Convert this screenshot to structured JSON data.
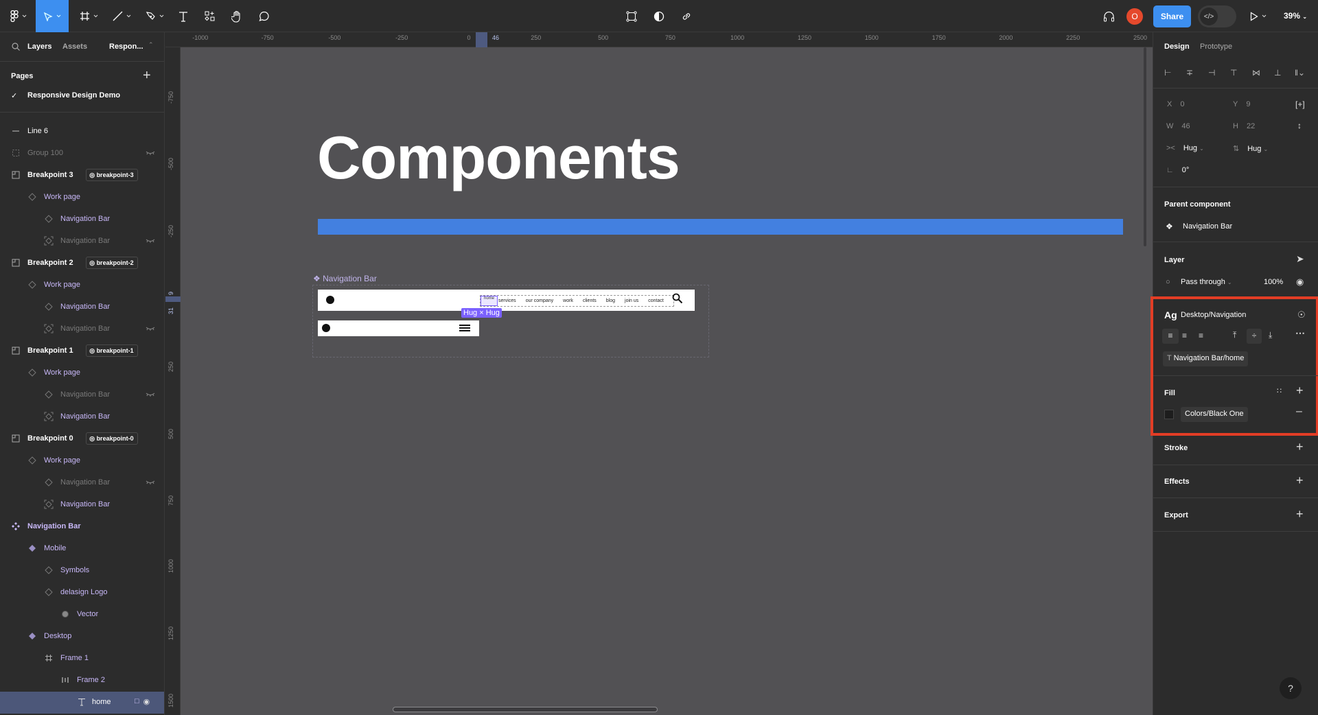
{
  "toolbar": {
    "tools": [
      "figma-menu",
      "move",
      "frame",
      "line",
      "pen",
      "text",
      "resources",
      "hand",
      "comment"
    ],
    "center_tools": [
      "edit-object",
      "contrast-mask",
      "link"
    ],
    "share_label": "Share",
    "avatar_initial": "O",
    "dev_mode_glyph": "</>",
    "zoom": "39%"
  },
  "left_panel": {
    "tabs": [
      "Layers",
      "Assets",
      "Respon..."
    ],
    "pages_title": "Pages",
    "current_page": "Responsive Design Demo",
    "layers": [
      {
        "label": "Line 6",
        "icon": "line",
        "indent": 0,
        "style": "normal"
      },
      {
        "label": "Group 100",
        "icon": "group",
        "indent": 0,
        "style": "dim",
        "hidden": true
      },
      {
        "label": "Breakpoint 3",
        "icon": "section",
        "indent": 0,
        "style": "bold",
        "badge": "breakpoint-3"
      },
      {
        "label": "Work page",
        "icon": "instance",
        "indent": 1,
        "style": "purple"
      },
      {
        "label": "Navigation Bar",
        "icon": "instance",
        "indent": 2,
        "style": "purple"
      },
      {
        "label": "Navigation Bar",
        "icon": "instance-frame",
        "indent": 2,
        "style": "dim",
        "hidden": true
      },
      {
        "label": "Breakpoint 2",
        "icon": "section",
        "indent": 0,
        "style": "bold",
        "badge": "breakpoint-2"
      },
      {
        "label": "Work page",
        "icon": "instance",
        "indent": 1,
        "style": "purple"
      },
      {
        "label": "Navigation Bar",
        "icon": "instance",
        "indent": 2,
        "style": "purple"
      },
      {
        "label": "Navigation Bar",
        "icon": "instance-frame",
        "indent": 2,
        "style": "dim",
        "hidden": true
      },
      {
        "label": "Breakpoint 1",
        "icon": "section",
        "indent": 0,
        "style": "bold",
        "badge": "breakpoint-1"
      },
      {
        "label": "Work page",
        "icon": "instance",
        "indent": 1,
        "style": "purple"
      },
      {
        "label": "Navigation Bar",
        "icon": "instance",
        "indent": 2,
        "style": "dim",
        "hidden": true
      },
      {
        "label": "Navigation Bar",
        "icon": "instance-frame",
        "indent": 2,
        "style": "purple"
      },
      {
        "label": "Breakpoint 0",
        "icon": "section",
        "indent": 0,
        "style": "bold",
        "badge": "breakpoint-0"
      },
      {
        "label": "Work page",
        "icon": "instance",
        "indent": 1,
        "style": "purple"
      },
      {
        "label": "Navigation Bar",
        "icon": "instance",
        "indent": 2,
        "style": "dim",
        "hidden": true
      },
      {
        "label": "Navigation Bar",
        "icon": "instance-frame",
        "indent": 2,
        "style": "purple"
      },
      {
        "label": "Navigation Bar",
        "icon": "component-set",
        "indent": 0,
        "style": "purple-bold"
      },
      {
        "label": "Mobile",
        "icon": "component",
        "indent": 1,
        "style": "purple"
      },
      {
        "label": "Symbols",
        "icon": "instance",
        "indent": 2,
        "style": "purple"
      },
      {
        "label": "delasign Logo",
        "icon": "instance",
        "indent": 2,
        "style": "purple"
      },
      {
        "label": "Vector",
        "icon": "vector",
        "indent": 3,
        "style": "purple"
      },
      {
        "label": "Desktop",
        "icon": "component",
        "indent": 1,
        "style": "purple"
      },
      {
        "label": "Frame 1",
        "icon": "frame",
        "indent": 2,
        "style": "purple"
      },
      {
        "label": "Frame 2",
        "icon": "autolayout",
        "indent": 3,
        "style": "purple"
      },
      {
        "label": "home",
        "icon": "text",
        "indent": 4,
        "style": "selected"
      }
    ]
  },
  "rulers": {
    "horizontal": [
      "-1000",
      "-750",
      "-500",
      "-250",
      "0",
      "250",
      "500",
      "750",
      "1000",
      "1250",
      "1500",
      "1750",
      "2000",
      "2250",
      "2500"
    ],
    "horizontal_selection": "46",
    "vertical": [
      "-750",
      "-500",
      "-250",
      "250",
      "500",
      "750",
      "1000",
      "1250",
      "1500"
    ],
    "vertical_selection": [
      "9",
      "31"
    ]
  },
  "canvas": {
    "title": "Components",
    "accent_bar_color": "#4380e0",
    "component_label": "Navigation Bar",
    "nav_links": [
      "home",
      "services",
      "our company",
      "work",
      "clients",
      "blog",
      "join us",
      "contact"
    ],
    "hug_label": "Hug × Hug"
  },
  "right_panel": {
    "tabs": [
      "Design",
      "Prototype"
    ],
    "x": "0",
    "y": "9",
    "w": "46",
    "h": "22",
    "width_mode": "Hug",
    "height_mode": "Hug",
    "rotation": "0°",
    "parent_component_title": "Parent component",
    "parent_component": "Navigation Bar",
    "layer_title": "Layer",
    "blend_mode": "Pass through",
    "opacity": "100%",
    "text_style": "Desktop/Navigation",
    "text_style_prefix": "Ag",
    "text_content_chip": "Navigation Bar/home",
    "fill_title": "Fill",
    "fill_style": "Colors/Black One",
    "stroke_title": "Stroke",
    "effects_title": "Effects",
    "export_title": "Export",
    "highlight_color": "#e23d25"
  },
  "help_glyph": "?"
}
